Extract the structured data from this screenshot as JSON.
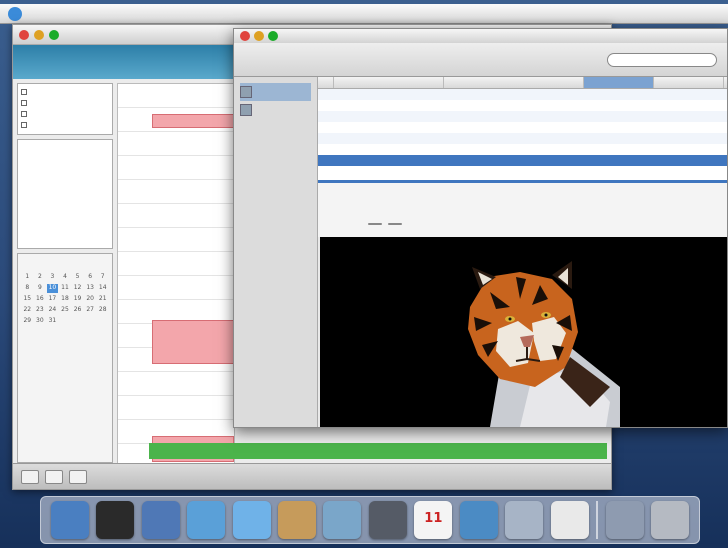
{
  "menubar": {
    "items": [],
    "clock": ""
  },
  "calendar_window": {
    "calendars": [
      {
        "label": ""
      },
      {
        "label": ""
      },
      {
        "label": ""
      },
      {
        "label": ""
      }
    ],
    "mini_calendar": {
      "month": "",
      "days": [
        "",
        "",
        "",
        "",
        "",
        "",
        "",
        "1",
        "2",
        "3",
        "4",
        "5",
        "6",
        "7",
        "8",
        "9",
        "10",
        "11",
        "12",
        "13",
        "14",
        "15",
        "16",
        "17",
        "18",
        "19",
        "20",
        "21",
        "22",
        "23",
        "24",
        "25",
        "26",
        "27",
        "28",
        "29",
        "30",
        "31"
      ],
      "today_index": 16
    },
    "hours": [
      "",
      "",
      "",
      "",
      "",
      "",
      "",
      "",
      "",
      "",
      "",
      "",
      "",
      "",
      "",
      ""
    ],
    "events": [
      {
        "title": ""
      },
      {
        "title": ""
      },
      {
        "title": ""
      }
    ],
    "view_modes": []
  },
  "mail_window": {
    "title": "",
    "toolbar": [],
    "search_placeholder": "",
    "mailboxes": [
      {
        "label": ""
      },
      {
        "label": ""
      }
    ],
    "columns": [
      "",
      "",
      "",
      "",
      ""
    ],
    "messages": [
      {
        "from": "",
        "subject": "",
        "date": "",
        "size": ""
      },
      {
        "from": "",
        "subject": "",
        "date": "",
        "size": ""
      },
      {
        "from": "",
        "subject": "",
        "date": "",
        "size": ""
      },
      {
        "from": "",
        "subject": "",
        "date": "",
        "size": ""
      },
      {
        "from": "",
        "subject": "",
        "date": "",
        "size": ""
      },
      {
        "from": "",
        "subject": "",
        "date": "",
        "size": ""
      },
      {
        "from": "",
        "subject": "",
        "date": "",
        "size": ""
      }
    ],
    "selected_message_index": 6,
    "header_fields": [
      {
        "key": "",
        "value": ""
      },
      {
        "key": "",
        "value": ""
      },
      {
        "key": "",
        "value": ""
      },
      {
        "key": "",
        "value": ""
      }
    ],
    "header_buttons": [
      "",
      ""
    ],
    "attachment_image": "tiger-photo"
  },
  "dock": {
    "apps": [
      {
        "icon": "finder-icon",
        "color": "#4a7fc1"
      },
      {
        "icon": "itunes-icon",
        "color": "#2a2a2a"
      },
      {
        "icon": "mail-icon",
        "color": "#4f78b6"
      },
      {
        "icon": "safari-icon",
        "color": "#5aa0d8"
      },
      {
        "icon": "ichat-icon",
        "color": "#6fb2e8"
      },
      {
        "icon": "address-book-icon",
        "color": "#c69b5b"
      },
      {
        "icon": "iphoto-icon",
        "color": "#7aa6c9"
      },
      {
        "icon": "preferences-icon",
        "color": "#555b66"
      },
      {
        "icon": "ical-icon",
        "color": "#f4f4f4",
        "number": "11"
      },
      {
        "icon": "imovie-icon",
        "color": "#4b8bc4"
      },
      {
        "icon": "idvd-icon",
        "color": "#a7b4c6"
      },
      {
        "icon": "documents-icon",
        "color": "#e9e9e9"
      }
    ],
    "trash": [
      {
        "icon": "download-folder-icon",
        "color": "#8e9bb0"
      },
      {
        "icon": "trash-icon",
        "color": "#b5bac2"
      }
    ]
  }
}
